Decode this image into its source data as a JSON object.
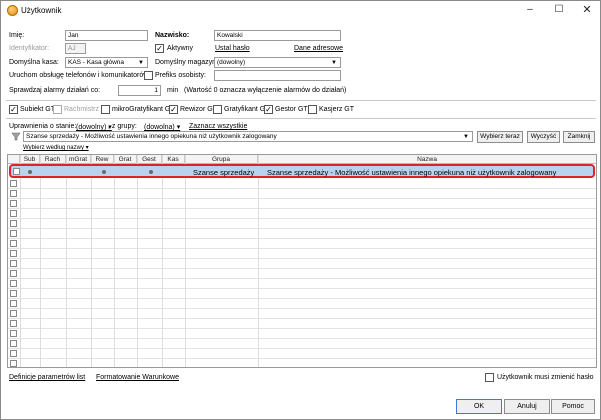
{
  "window": {
    "title": "Użytkownik",
    "minimize": "–",
    "maximize": "☐",
    "close": "✕"
  },
  "form": {
    "imie_label": "Imię:",
    "imie_value": "Jan",
    "nazwisko_label": "Nazwisko:",
    "nazwisko_value": "Kowalski",
    "identyfikator_label": "Identyfikator:",
    "identyfikator_value": "AJ",
    "aktywny_label": "Aktywny",
    "aktywny_checked": true,
    "ustal_haslo": "Ustal hasło",
    "dane_adresowe": "Dane adresowe",
    "kasa_label": "Domyślna kasa:",
    "kasa_value": "KAS - Kasa główna",
    "magazyn_label": "Domyślny magazyn:",
    "magazyn_value": "(dowolny)",
    "uruchom_label": "Uruchom obsługę telefonów i komunikatorów",
    "prefiks_label": "Prefiks osobisty:",
    "prefiks_value": "",
    "alarmy_label": "Sprawdzaj alarmy działań co:",
    "alarmy_value": "1",
    "alarmy_unit": "min",
    "alarmy_note": "(Wartość 0 oznacza wyłączenie alarmów do działań)"
  },
  "roles": [
    {
      "label": "Subiekt GT",
      "checked": true,
      "disabled": false
    },
    {
      "label": "Rachmistrz GT",
      "checked": false,
      "disabled": true
    },
    {
      "label": "mikroGratyfikant GT",
      "checked": false,
      "disabled": false
    },
    {
      "label": "Rewizor GT",
      "checked": true,
      "disabled": false
    },
    {
      "label": "Gratyfikant GT",
      "checked": false,
      "disabled": false
    },
    {
      "label": "Gestor GT",
      "checked": true,
      "disabled": false
    },
    {
      "label": "Kasjerz GT",
      "checked": false,
      "disabled": false
    }
  ],
  "filters": {
    "stan_label": "Uprawnienia o stanie:",
    "stan_value": "(dowolny)",
    "grupa_label": ", z grupy:",
    "grupa_value": "(dowolna)",
    "zaznacz_wszystkie": "Zaznacz wszystkie",
    "search_value": "Szanse sprzedaży - Możliwość ustawienia innego opiekuna niż użytkownik zalogowany",
    "wybierz_teraz": "Wybierz teraz",
    "wyczysc": "Wyczyść",
    "zamknij": "Zamknij",
    "wybierz_wedlug": "Wybierz według nazwy"
  },
  "grid": {
    "columns": [
      "Sub",
      "Rach",
      "mGrat",
      "Rew",
      "Grat",
      "Gest",
      "Kas",
      "Grupa",
      "Nazwa"
    ],
    "rows": [
      {
        "grupa": "Szanse sprzedaży",
        "nazwa": "Szanse sprzedaży - Możliwość ustawienia innego opiekuna niż użytkownik zalogowany",
        "dots": [
          "Sub",
          "Rew",
          "Gest"
        ]
      }
    ]
  },
  "footer": {
    "definicje": "Definicje parametrów list",
    "formatowanie": "Formatowanie Warunkowe",
    "musi_zmienic": "Użytkownik musi zmienić hasło",
    "ok": "OK",
    "anuluj": "Anuluj",
    "pomoc": "Pomoc"
  }
}
